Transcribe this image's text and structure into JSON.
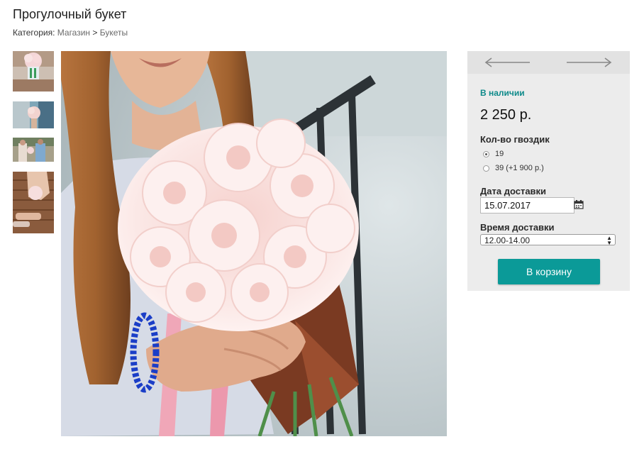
{
  "product": {
    "title": "Прогулочный букет",
    "breadcrumb": {
      "prefix": "Категория: ",
      "shop": "Магазин",
      "sep": " > ",
      "category": "Букеты"
    }
  },
  "gallery": {
    "thumbnails": [
      "bouquet-on-stand",
      "person-holding-flowers",
      "couple-outdoors",
      "woman-with-bouquet-bench"
    ],
    "main_image": "woman-holding-pink-carnation-bouquet"
  },
  "purchase": {
    "stock_status": "В наличии",
    "price": "2 250 р.",
    "quantity_label": "Кол-во гвоздик",
    "quantity_options": [
      {
        "label": "19",
        "selected": true
      },
      {
        "label": "39 (+1 900 р.)",
        "selected": false
      }
    ],
    "delivery_date_label": "Дата доставки",
    "delivery_date_value": "15.07.2017",
    "delivery_time_label": "Время доставки",
    "delivery_time_value": "12.00-14.00",
    "cart_button": "В корзину"
  },
  "colors": {
    "accent": "#0b9a98",
    "stock": "#0e8a8a",
    "panel": "#ececec"
  }
}
